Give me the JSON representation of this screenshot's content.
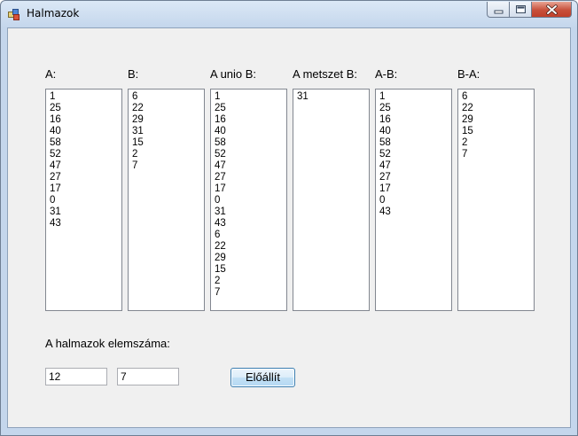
{
  "window": {
    "title": "Halmazok",
    "buttons": {
      "minimize": "minimize-icon",
      "maximize": "maximize-icon",
      "close": "close-icon"
    }
  },
  "lists": [
    {
      "label": "A:",
      "items": [
        "1",
        "25",
        "16",
        "40",
        "58",
        "52",
        "47",
        "27",
        "17",
        "0",
        "31",
        "43"
      ]
    },
    {
      "label": "B:",
      "items": [
        "6",
        "22",
        "29",
        "31",
        "15",
        "2",
        "7"
      ]
    },
    {
      "label": "A unio B:",
      "items": [
        "1",
        "25",
        "16",
        "40",
        "58",
        "52",
        "47",
        "27",
        "17",
        "0",
        "31",
        "43",
        "6",
        "22",
        "29",
        "15",
        "2",
        "7"
      ]
    },
    {
      "label": "A metszet B:",
      "items": [
        "31"
      ]
    },
    {
      "label": "A-B:",
      "items": [
        "1",
        "25",
        "16",
        "40",
        "58",
        "52",
        "47",
        "27",
        "17",
        "0",
        "43"
      ]
    },
    {
      "label": "B-A:",
      "items": [
        "6",
        "22",
        "29",
        "15",
        "2",
        "7"
      ]
    }
  ],
  "counts": {
    "label": "A halmazok elemszáma:",
    "a_value": "12",
    "b_value": "7"
  },
  "actions": {
    "generate_label": "Előállít"
  },
  "colors": {
    "close_button": "#c7503b",
    "accent_border": "#3c7fb1"
  }
}
